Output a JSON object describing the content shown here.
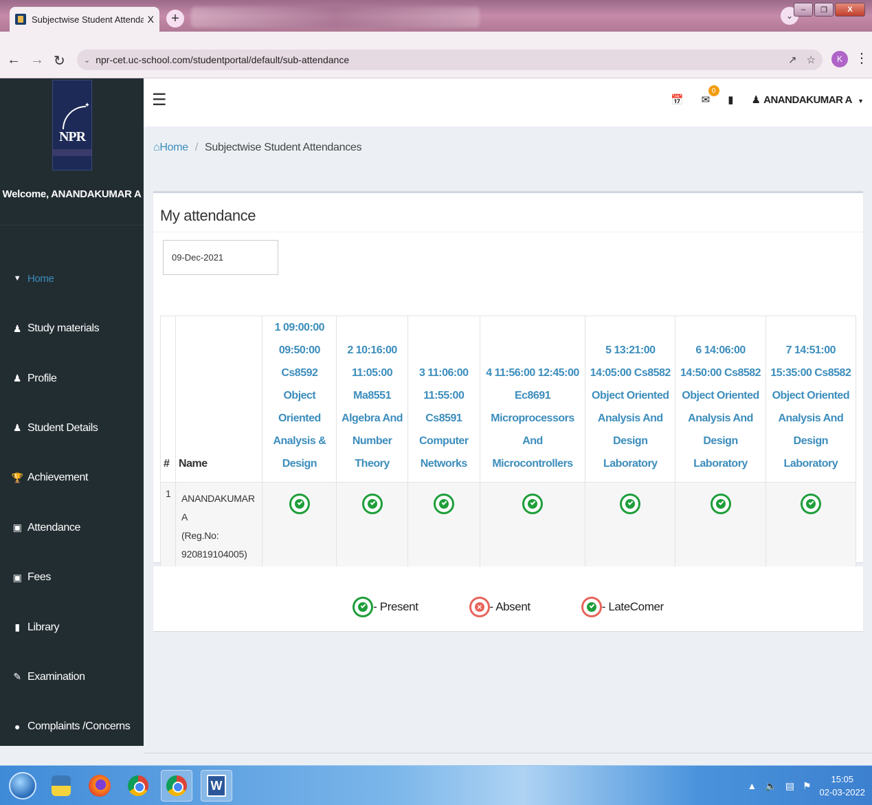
{
  "browser": {
    "tab_title": "Subjectwise Student Attendances",
    "tab_close": "X",
    "new_tab": "+",
    "url": "npr-cet.uc-school.com/studentportal/default/sub-attendance",
    "profile_initial": "K",
    "window_close": "X"
  },
  "sidebar": {
    "logo_text": "NPR",
    "welcome": "Welcome, ANANDAKUMAR A",
    "items": [
      {
        "label": "Home",
        "icon": "chevron-down-icon"
      },
      {
        "label": "Study materials",
        "icon": "users-icon"
      },
      {
        "label": "Profile",
        "icon": "user-icon"
      },
      {
        "label": "Student Details",
        "icon": "user-icon"
      },
      {
        "label": "Achievement",
        "icon": "trophy-icon"
      },
      {
        "label": "Attendance",
        "icon": "money-icon"
      },
      {
        "label": "Fees",
        "icon": "money-icon"
      },
      {
        "label": "Library",
        "icon": "book-icon"
      },
      {
        "label": "Examination",
        "icon": "pencil-icon"
      },
      {
        "label": "Complaints /Concerns",
        "icon": "comment-icon"
      }
    ]
  },
  "header": {
    "notification_count": "0",
    "user_name": "ANANDAKUMAR A"
  },
  "breadcrumb": {
    "home": "Home",
    "current": "Subjectwise Student Attendances"
  },
  "attendance": {
    "title": "My attendance",
    "date": "09-Dec-2021",
    "columns": {
      "num": "#",
      "name": "Name",
      "periods": [
        {
          "lines": [
            "1 09:00:00",
            "09:50:00",
            "Cs8592 Object",
            "Oriented",
            "Analysis &",
            "Design"
          ]
        },
        {
          "lines": [
            "2 10:16:00",
            "11:05:00",
            "Ma8551",
            "Algebra And",
            "Number",
            "Theory"
          ]
        },
        {
          "lines": [
            "3 11:06:00",
            "11:55:00",
            "Cs8591",
            "Computer",
            "Networks"
          ]
        },
        {
          "lines": [
            "4 11:56:00 12:45:00",
            "Ec8691",
            "Microprocessors And",
            "Microcontrollers"
          ]
        },
        {
          "lines": [
            "5 13:21:00",
            "14:05:00 Cs8582",
            "Object Oriented",
            "Analysis And",
            "Design Laboratory"
          ]
        },
        {
          "lines": [
            "6 14:06:00",
            "14:50:00 Cs8582",
            "Object Oriented",
            "Analysis And",
            "Design Laboratory"
          ]
        },
        {
          "lines": [
            "7 14:51:00",
            "15:35:00 Cs8582",
            "Object Oriented",
            "Analysis And",
            "Design Laboratory"
          ]
        }
      ]
    },
    "rows": [
      {
        "num": "1",
        "name_lines": [
          "ANANDAKUMAR A",
          "(Reg.No:",
          "920819104005)"
        ],
        "statuses": [
          "present",
          "present",
          "present",
          "present",
          "present",
          "present",
          "present"
        ]
      }
    ]
  },
  "legend": {
    "present": "- Present",
    "absent": "- Absent",
    "latecomer": "- LateComer"
  },
  "taskbar": {
    "time": "15:05",
    "date": "02-03-2022",
    "word_letter": "W"
  }
}
